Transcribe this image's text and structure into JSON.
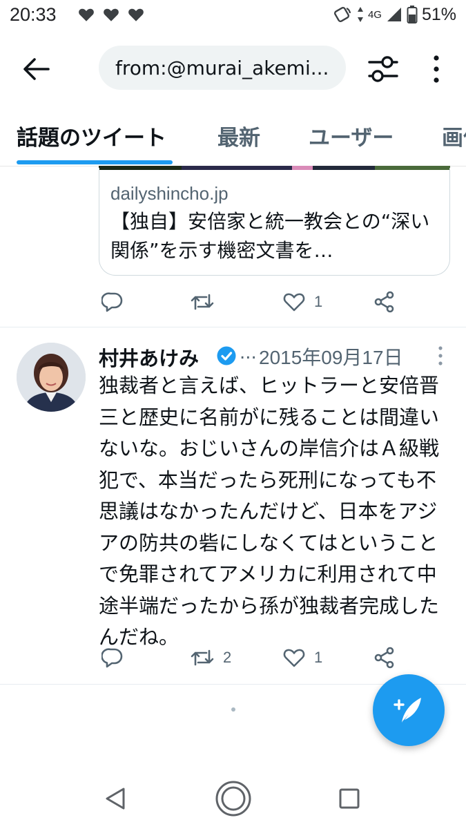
{
  "status_bar": {
    "time": "20:33",
    "network": "4G",
    "battery": "51%",
    "icons": [
      "heart-icon",
      "heart-icon",
      "heart-icon",
      "nfc-icon",
      "signal-icon",
      "battery-icon"
    ]
  },
  "search": {
    "query": "from:@murai_akemi..."
  },
  "tabs": [
    {
      "label": "話題のツイート",
      "active": true
    },
    {
      "label": "最新",
      "active": false
    },
    {
      "label": "ユーザー",
      "active": false
    },
    {
      "label": "画像",
      "active": false
    }
  ],
  "link_card": {
    "domain": "dailyshincho.jp",
    "title": "【独自】安倍家と統一教会との“深い関係”を示す機密文書を…"
  },
  "tweet1_actions": {
    "retweets": "",
    "likes": "1"
  },
  "tweet2": {
    "author": "村井あけみ",
    "handle": "...",
    "date": "2015年09月17日",
    "text": "独裁者と言えば、ヒットラーと安倍晋三と歴史に名前がに残ることは間違いないな。おじいさんの岸信介はＡ級戦犯で、本当だったら死刑になっても不思議はなかったんだけど、日本をアジアの防共の砦にしなくてはということで免罪されてアメリカに利用されて中途半端だったから孫が独裁者完成したんだね。",
    "retweets": "2",
    "likes": "1"
  },
  "colors": {
    "accent": "#1d9bf0",
    "text": "#0f1419",
    "secondary_text": "#536471"
  }
}
